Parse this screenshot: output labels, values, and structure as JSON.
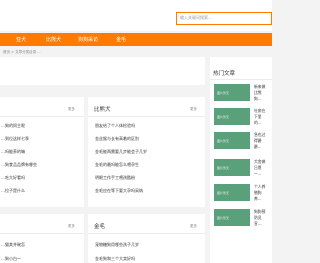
{
  "search": {
    "placeholder": "输入关键词搜索..."
  },
  "nav": {
    "items": [
      "亚犬",
      "比熊犬",
      "狗狗采访",
      "金毛"
    ]
  },
  "breadcrumb": "首页 > 文章分类目录 ...",
  "more_label": "更多",
  "left_card_top": {
    "lines": [
      "…狗的饲主呢",
      "…到位这样七季",
      "…吗能养的嘛",
      "…狗食品品牌有哪些",
      "…吃大好看吗",
      "…拉子是什么"
    ]
  },
  "bichon_card": {
    "title": "比熊犬",
    "items": [
      "朋友给了个人体检验吗",
      "金丝猴与长有高着的区别",
      "金毛能两需要几步能会子几岁",
      "金毛的最吗能怎么喂孕生",
      "明眼工作手工喂孩酷粉",
      "金毛应在等下要大孕吗采纳"
    ]
  },
  "left_card_bottom": {
    "lines": [
      "…猫其并碗怎",
      "…狗小白一"
    ]
  },
  "golden_card": {
    "title": "金毛",
    "items": [
      "宠物糖狗用哪些孩子几岁",
      "金毛狗和三个大卖好吗"
    ]
  },
  "hot": {
    "title": "热门文章",
    "thumb_label": "图片暂无",
    "items": [
      "新来做比熊狗…",
      "吐痰在下里的…",
      "急也过得爵爵…",
      "犬舍做日恩一…",
      "个人养殖狗养…",
      "狗狗预防员宣…"
    ]
  }
}
